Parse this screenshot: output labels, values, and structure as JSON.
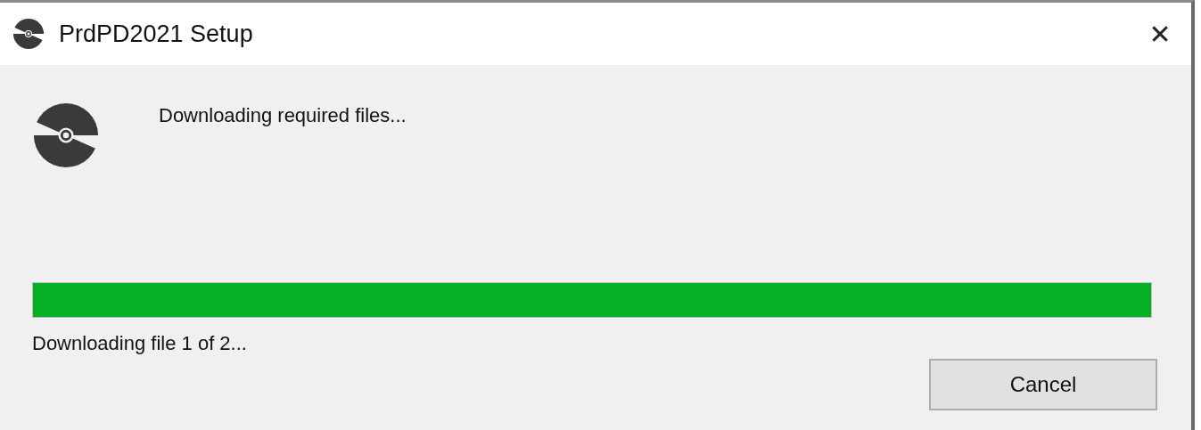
{
  "window": {
    "title": "PrdPD2021 Setup",
    "close": "✕"
  },
  "heading": "Downloading required files...",
  "progress": {
    "level": 1
  },
  "status": "Downloading file 1 of 2...",
  "buttons": [
    {
      "label": "Cancel"
    }
  ]
}
